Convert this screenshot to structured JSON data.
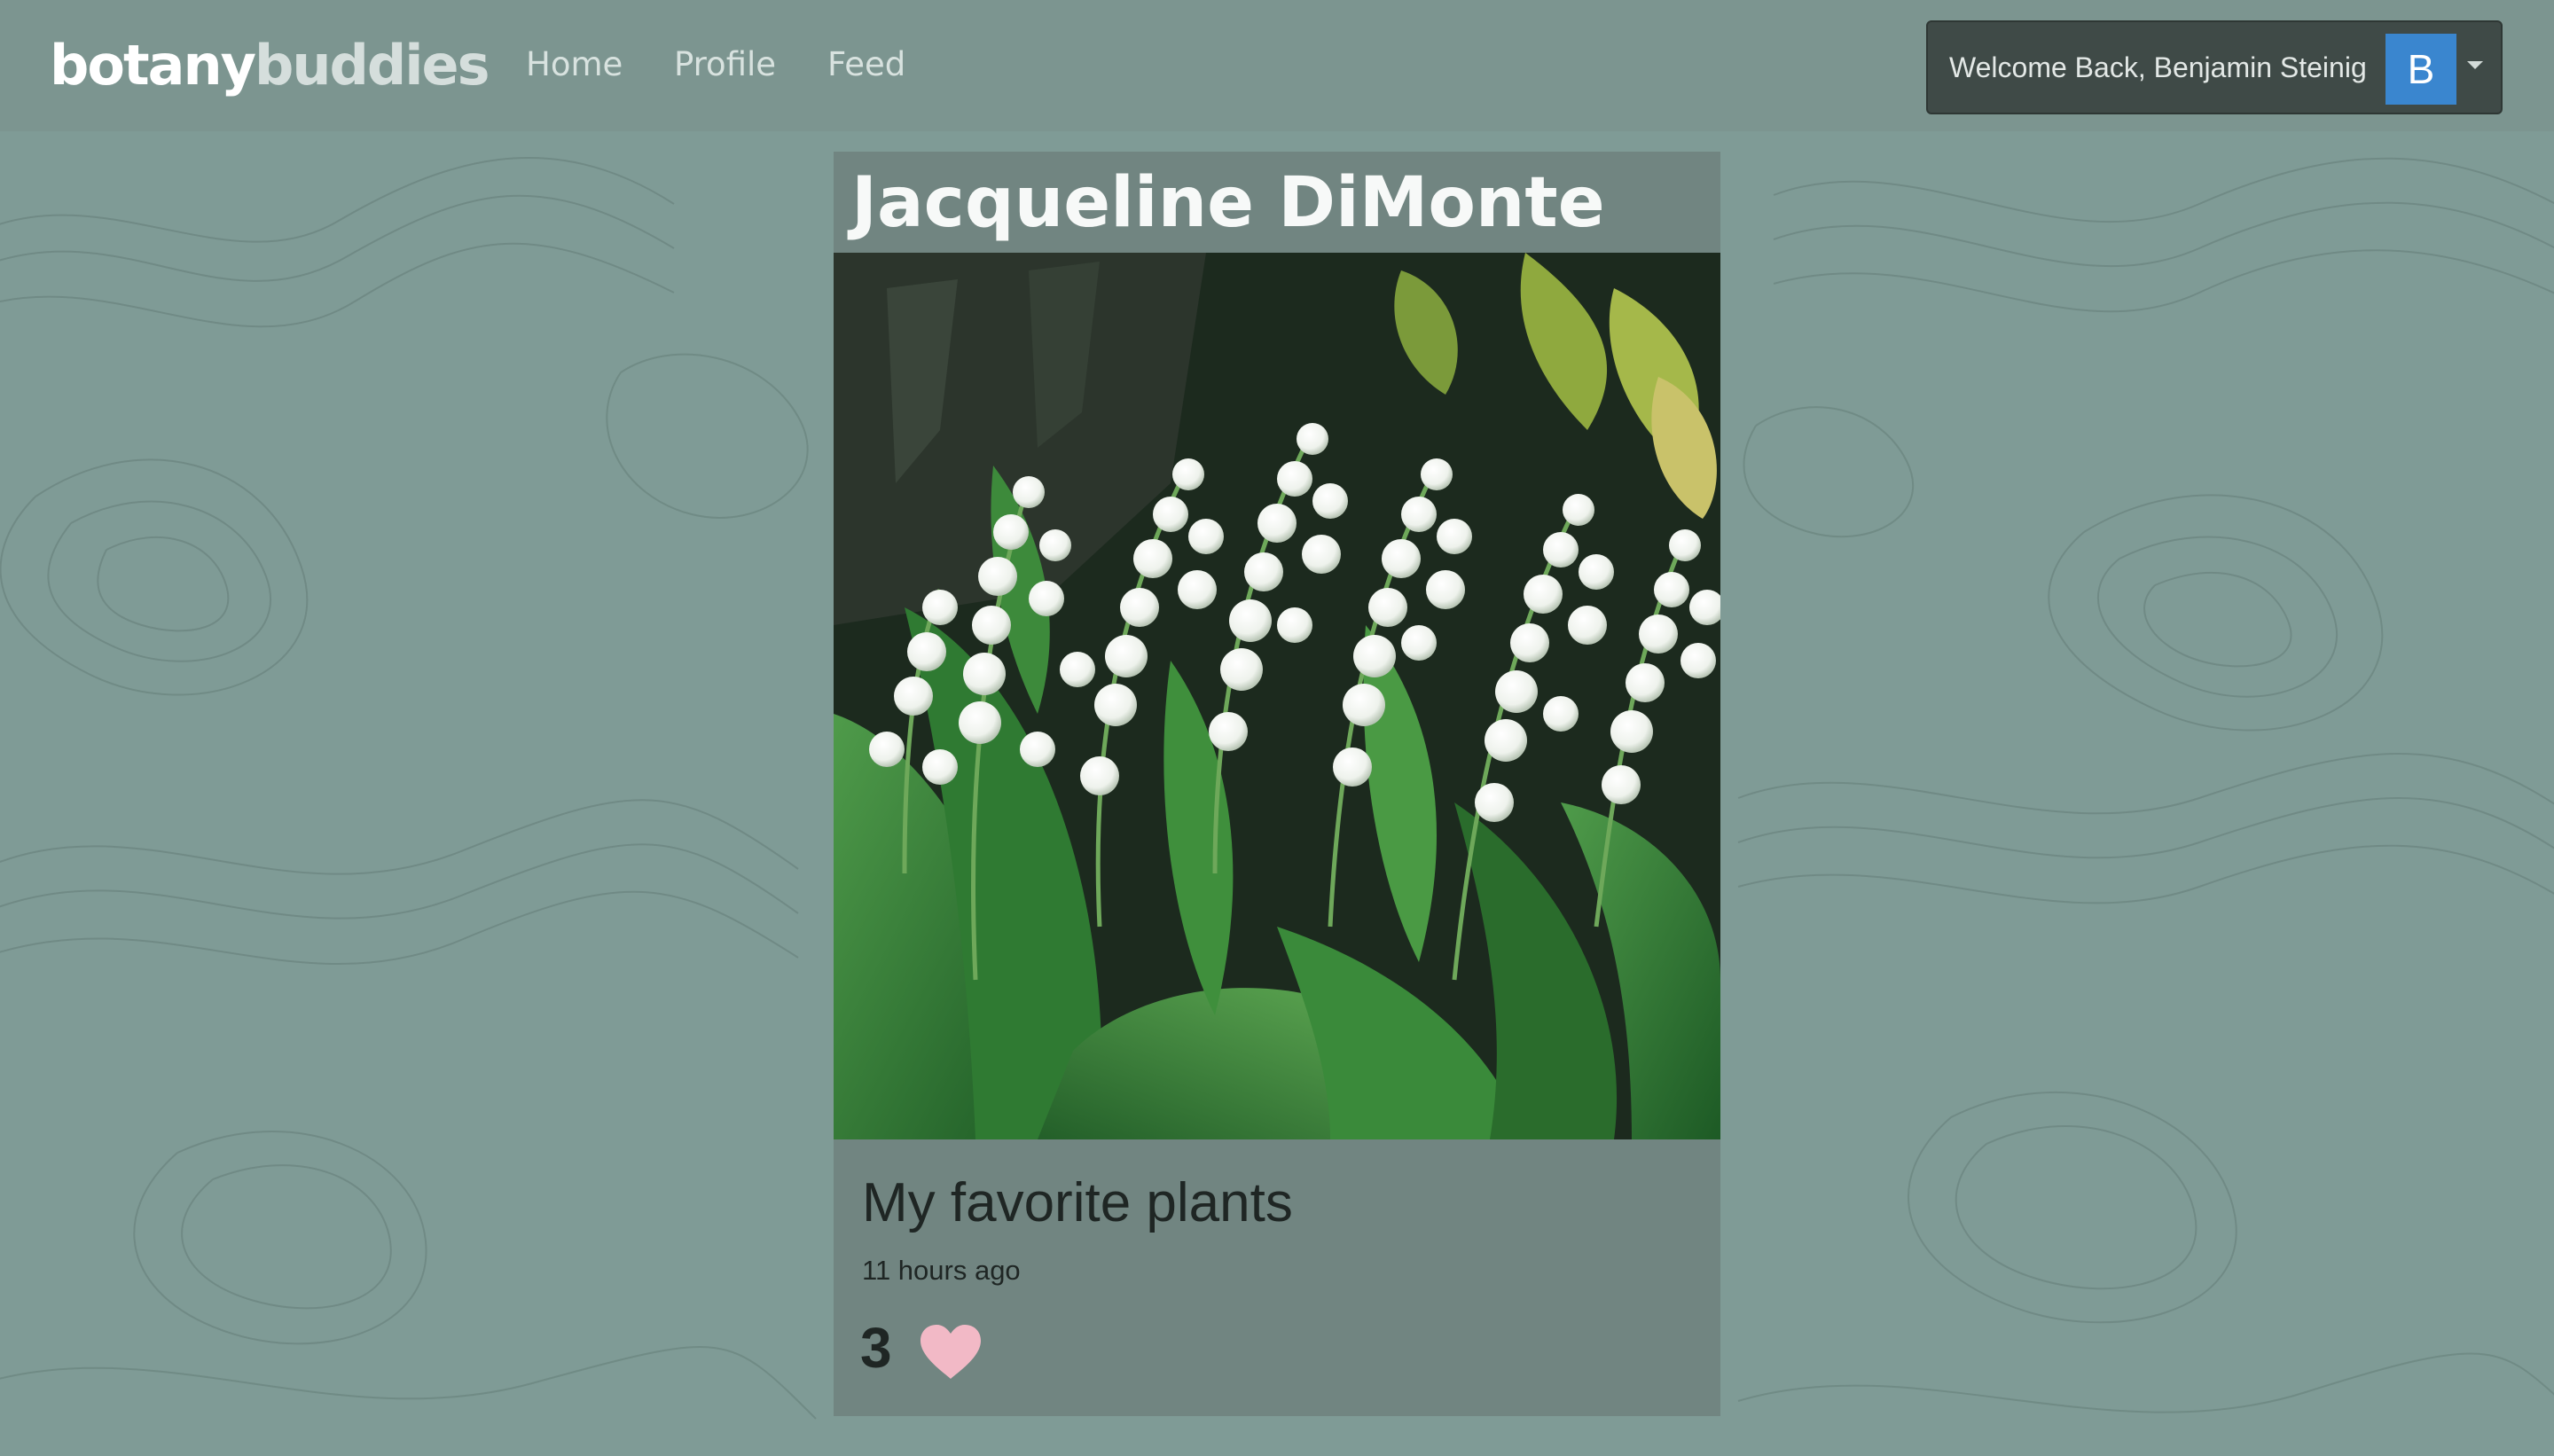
{
  "brand": {
    "part1": "botany",
    "part2": "buddies"
  },
  "nav": {
    "home": "Home",
    "profile": "Profile",
    "feed": "Feed"
  },
  "user_menu": {
    "welcome": "Welcome Back, Benjamin Steinig",
    "avatar_initial": "B"
  },
  "post": {
    "owner": "Jacqueline DiMonte",
    "photo_subject": "lily-of-the-valley-photo",
    "title": "My favorite plants",
    "time": "11 hours ago",
    "likes": "3"
  },
  "icons": {
    "like": "heart-icon",
    "menu_caret": "caret-down-icon"
  },
  "colors": {
    "background": "#7f9b96",
    "navbar": "#7c9590",
    "user_menu_bg": "#3f4a47",
    "avatar_bg": "#3a86cf",
    "heart": "#f2b9c6"
  }
}
